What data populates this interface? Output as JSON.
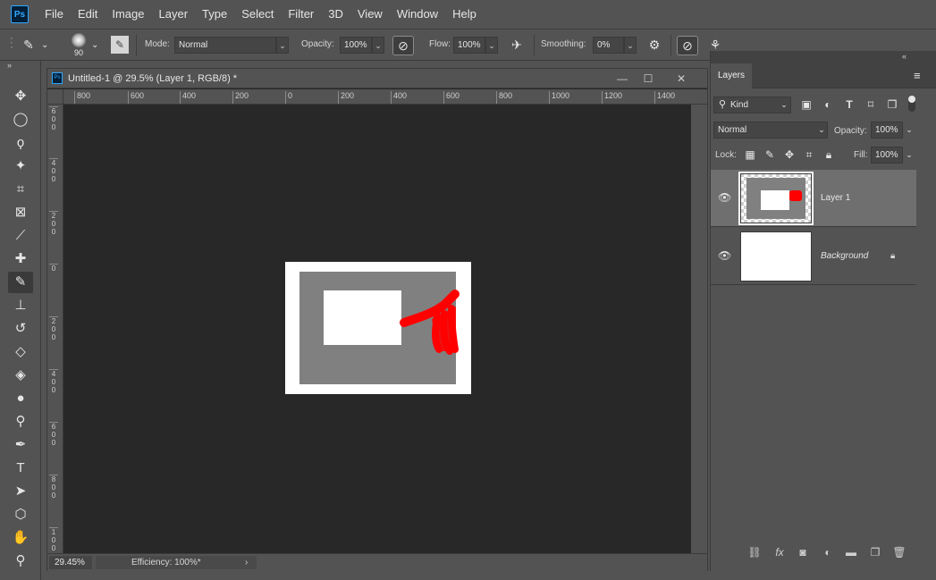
{
  "app": {
    "logo": "Ps"
  },
  "menu": [
    "File",
    "Edit",
    "Image",
    "Layer",
    "Type",
    "Select",
    "Filter",
    "3D",
    "View",
    "Window",
    "Help"
  ],
  "options": {
    "brush_size": "90",
    "mode_label": "Mode:",
    "mode_value": "Normal",
    "opacity_label": "Opacity:",
    "opacity_value": "100%",
    "flow_label": "Flow:",
    "flow_value": "100%",
    "smoothing_label": "Smoothing:",
    "smoothing_value": "0%"
  },
  "tools": [
    {
      "name": "move-tool",
      "glyph": "✥"
    },
    {
      "name": "marquee-tool",
      "glyph": "◯"
    },
    {
      "name": "lasso-tool",
      "glyph": "ϙ"
    },
    {
      "name": "magic-wand-tool",
      "glyph": "✦"
    },
    {
      "name": "crop-tool",
      "glyph": "⌗"
    },
    {
      "name": "frame-tool",
      "glyph": "⊠"
    },
    {
      "name": "eyedropper-tool",
      "glyph": "⟋"
    },
    {
      "name": "healing-brush-tool",
      "glyph": "✚"
    },
    {
      "name": "brush-tool",
      "glyph": "✎"
    },
    {
      "name": "clone-stamp-tool",
      "glyph": "⊥"
    },
    {
      "name": "history-brush-tool",
      "glyph": "↺"
    },
    {
      "name": "eraser-tool",
      "glyph": "◇"
    },
    {
      "name": "paint-bucket-tool",
      "glyph": "◈"
    },
    {
      "name": "blur-tool",
      "glyph": "●"
    },
    {
      "name": "dodge-tool",
      "glyph": "⚲"
    },
    {
      "name": "pen-tool",
      "glyph": "✒"
    },
    {
      "name": "type-tool",
      "glyph": "T"
    },
    {
      "name": "path-selection-tool",
      "glyph": "➤"
    },
    {
      "name": "shape-tool",
      "glyph": "⬡"
    },
    {
      "name": "hand-tool",
      "glyph": "✋"
    },
    {
      "name": "zoom-tool",
      "glyph": "⚲"
    }
  ],
  "document": {
    "title": "Untitled-1 @ 29.5% (Layer 1, RGB/8) *",
    "hruler": [
      "800",
      "600",
      "400",
      "200",
      "0",
      "200",
      "400",
      "600",
      "800",
      "1000",
      "1200",
      "1400"
    ],
    "vruler": [
      "600",
      "400",
      "200",
      "0",
      "200",
      "400",
      "600",
      "800",
      "1000"
    ],
    "zoom": "29.45%",
    "efficiency": "Efficiency: 100%*"
  },
  "layers_panel": {
    "tab": "Layers",
    "filter": "Kind",
    "blend_mode": "Normal",
    "opacity_label": "Opacity:",
    "opacity_value": "100%",
    "lock_label": "Lock:",
    "fill_label": "Fill:",
    "fill_value": "100%",
    "layers": [
      {
        "name": "Layer 1",
        "selected": true
      },
      {
        "name": "Background",
        "selected": false
      }
    ]
  },
  "colors": {
    "stroke_red": "#ff0000",
    "canvas_gray": "#808080",
    "app_bg": "#535353",
    "pasteboard": "#282828"
  }
}
